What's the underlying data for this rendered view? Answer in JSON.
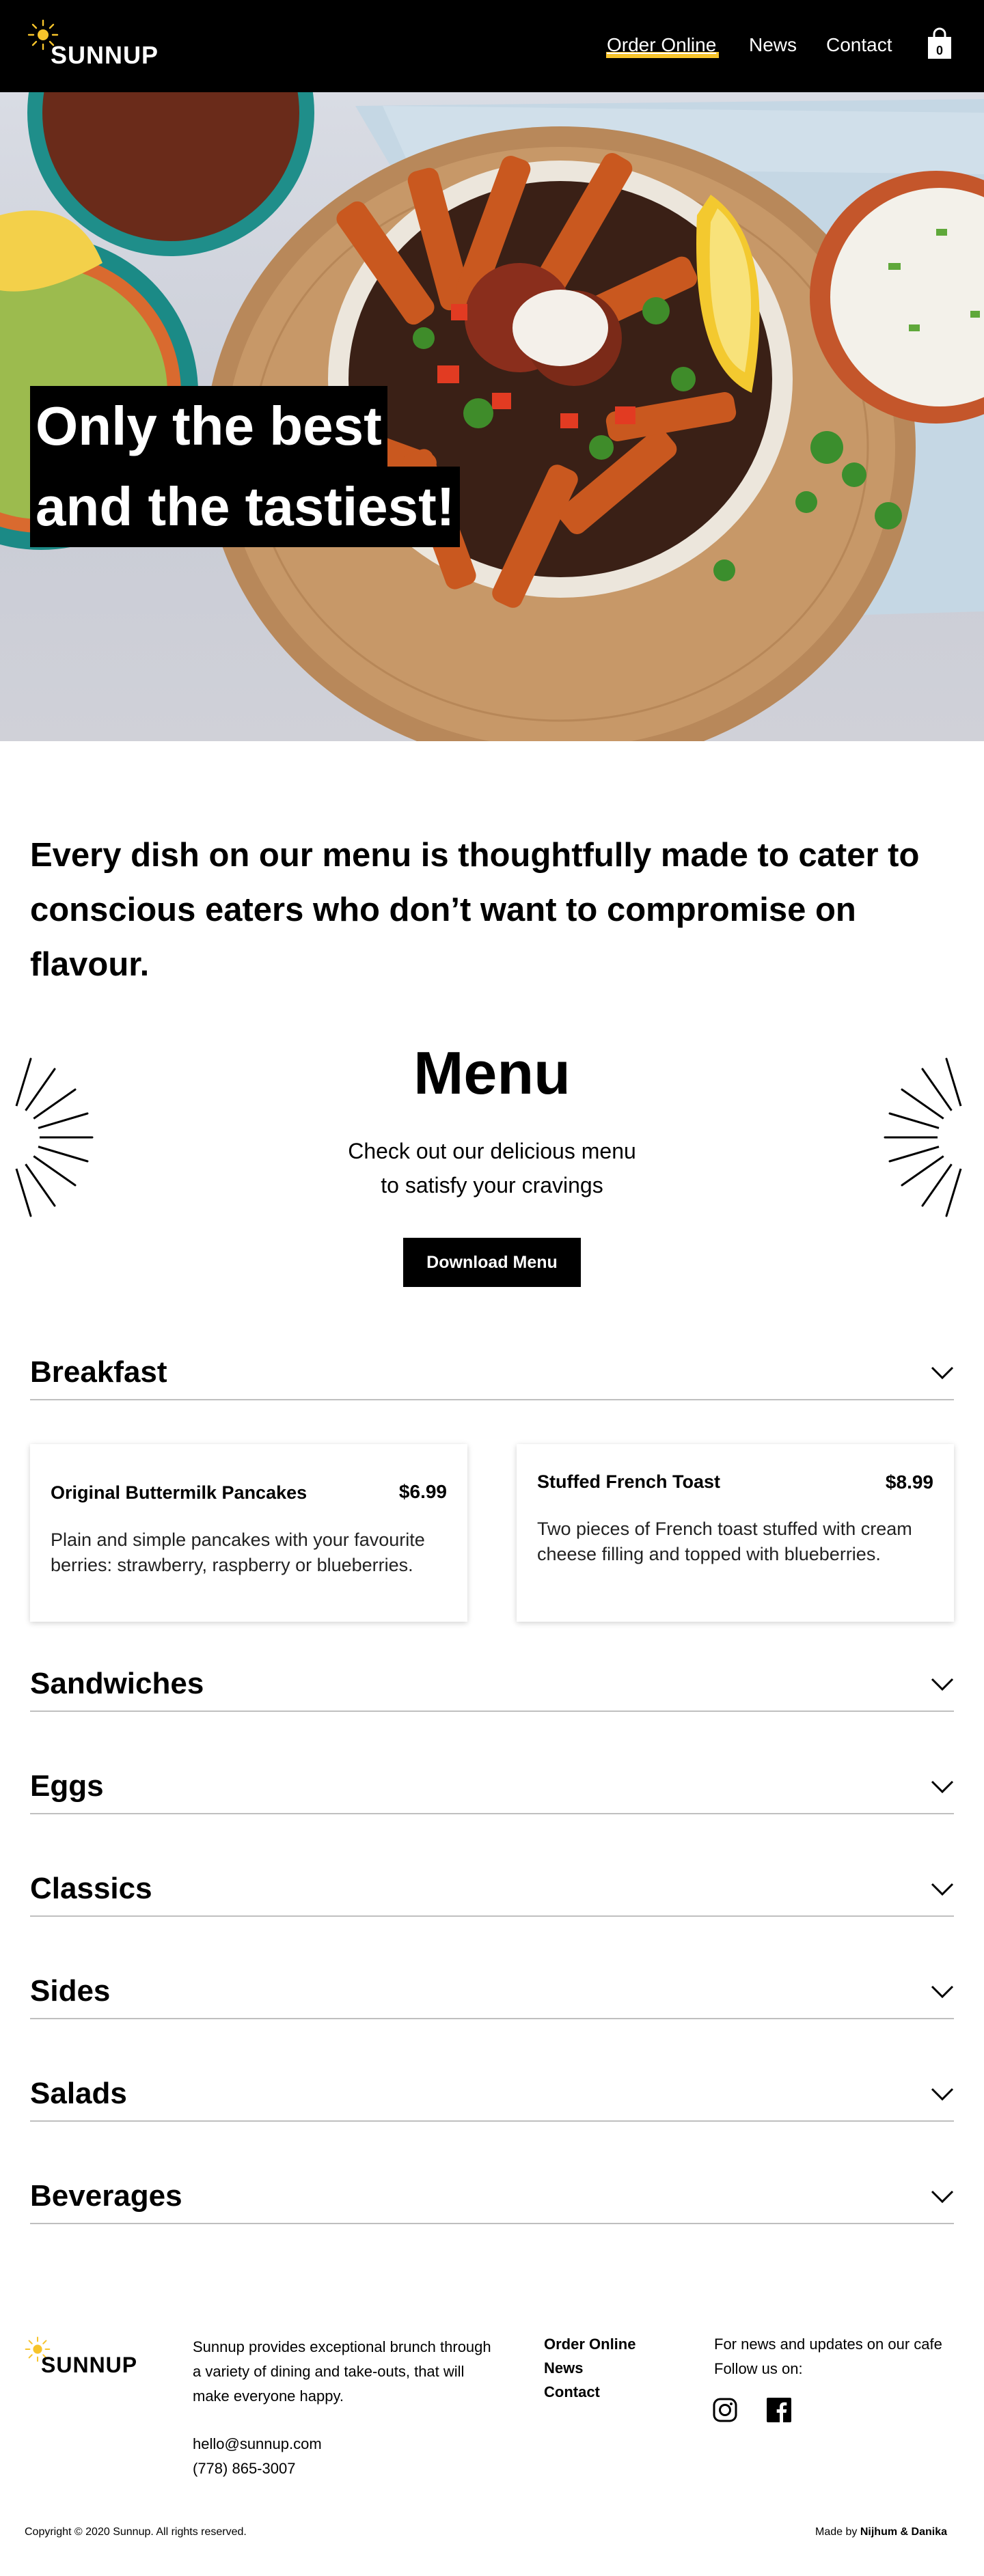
{
  "header": {
    "logo_text": "SUNNUP",
    "nav": {
      "order_online": "Order Online",
      "news": "News",
      "contact": "Contact"
    },
    "cart_count": "0"
  },
  "hero": {
    "line1": "Only the best",
    "line2": "and the tastiest!"
  },
  "intro": {
    "text": "Every dish on our menu is thoughtfully made to cater to conscious eaters who don’t want to compromise on flavour."
  },
  "menu": {
    "title": "Menu",
    "subtitle_line1": "Check out our delicious menu",
    "subtitle_line2": "to satisfy your cravings",
    "download_label": "Download Menu",
    "categories": [
      {
        "label": "Breakfast"
      },
      {
        "label": "Sandwiches"
      },
      {
        "label": "Eggs"
      },
      {
        "label": "Classics"
      },
      {
        "label": "Sides"
      },
      {
        "label": "Salads"
      },
      {
        "label": "Beverages"
      }
    ],
    "breakfast_items": [
      {
        "name": "Original Buttermilk Pancakes",
        "price": "$6.99",
        "description": "Plain and simple pancakes with your favourite berries: strawberry, raspberry or blueberries."
      },
      {
        "name": "Stuffed French Toast",
        "price": "$8.99",
        "description": "Two pieces of French toast stuffed with cream cheese filling and topped with blueberries."
      }
    ]
  },
  "footer": {
    "logo_text": "SUNNUP",
    "about": "Sunnup provides exceptional brunch through a variety of dining and take-outs, that will make everyone happy.",
    "email": "hello@sunnup.com",
    "phone": "(778) 865-3007",
    "links": {
      "order_online": "Order Online",
      "news": "News",
      "contact": "Contact"
    },
    "news_line1": "For news and updates on our cafe",
    "news_line2": "Follow us on:",
    "copyright": "Copyright © 2020 Sunnup. All rights reserved.",
    "made_by_prefix": "Made by",
    "made_by_names": "Nijhum & Danika"
  },
  "colors": {
    "brand_yellow": "#f7c42b",
    "header_bg": "#000000"
  },
  "icons": [
    "sun-icon",
    "shopping-bag-icon",
    "chevron-down-icon",
    "burst-icon",
    "instagram-icon",
    "facebook-icon"
  ]
}
